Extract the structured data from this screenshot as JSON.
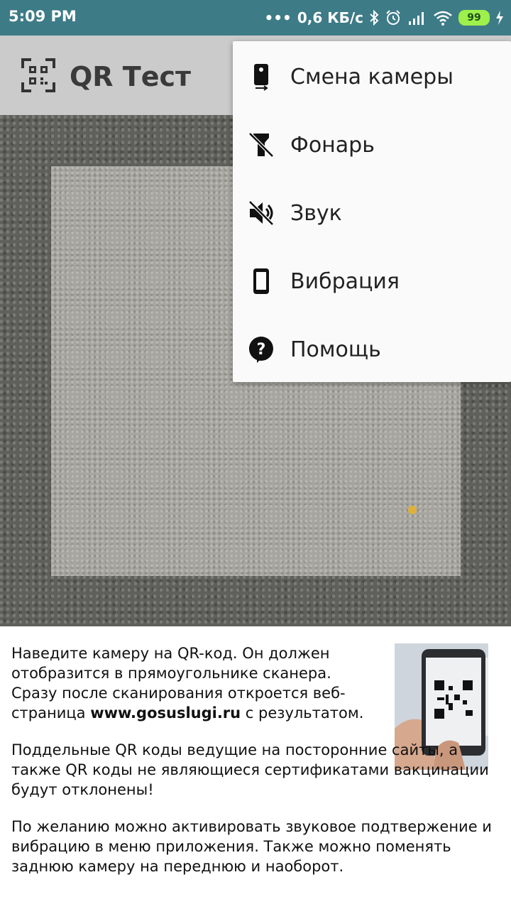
{
  "status_bar": {
    "time": "5:09 PM",
    "speed": "0,6 КБ/с",
    "battery": "99"
  },
  "app_bar": {
    "title": "QR Тест",
    "logo_icon": "qr-scan-icon"
  },
  "menu": {
    "items": [
      {
        "label": "Смена камеры",
        "icon": "switch-camera-icon"
      },
      {
        "label": "Фонарь",
        "icon": "flashlight-off-icon"
      },
      {
        "label": "Звук",
        "icon": "volume-off-icon"
      },
      {
        "label": "Вибрация",
        "icon": "phone-vibrate-icon"
      },
      {
        "label": "Помощь",
        "icon": "help-icon"
      }
    ]
  },
  "info": {
    "p1_text": "Наведите камеру на QR-код. Он должен отобразится в прямоугольнике сканера. Сразу после сканирования откроется веб-страница ",
    "p1_bold": "www.gosuslugi.ru",
    "p1_tail": " с результатом.",
    "p2": "Поддельные QR коды ведущие на посторонние сайты, а также QR коды не являющиеся сертификатами вакцинации будут отклонены!",
    "p3": "По желанию можно активировать звуковое подтвержение и вибрацию в меню приложения. Также можно поменять заднюю камеру на переднюю и наоборот."
  },
  "colors": {
    "status_bar": "#3d7b87",
    "app_bar": "#cbcbcb",
    "menu_bg": "#fafafa"
  }
}
